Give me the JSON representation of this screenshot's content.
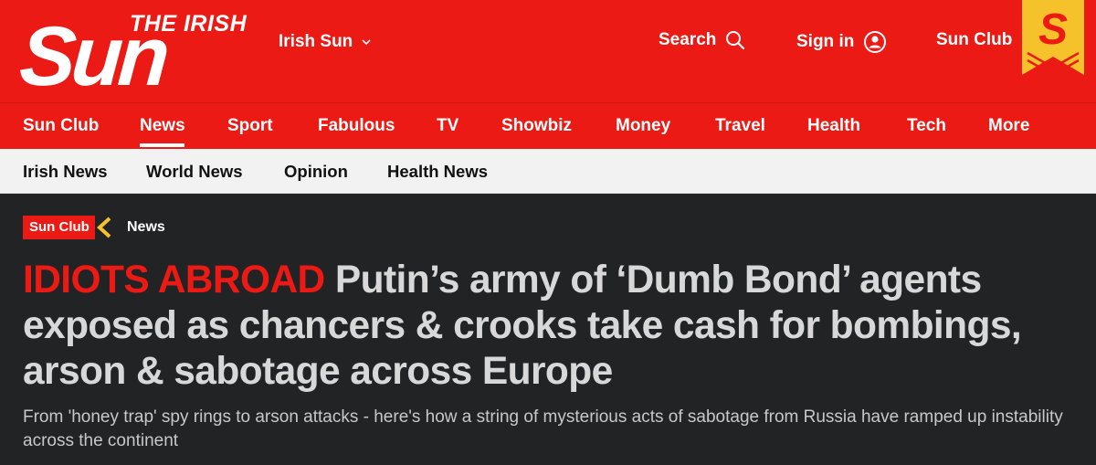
{
  "brand": {
    "logo_small": "THE IRISH",
    "logo_big": "Sun",
    "badge_letter": "S"
  },
  "header": {
    "edition_label": "Irish Sun",
    "search_label": "Search",
    "signin_label": "Sign in",
    "sunclub_label": "Sun Club",
    "colors": {
      "brand_red": "#eb1a14",
      "badge_yellow": "#f6c22b"
    }
  },
  "main_nav": {
    "items": [
      {
        "label": "Sun Club"
      },
      {
        "label": "News"
      },
      {
        "label": "Sport"
      },
      {
        "label": "Fabulous"
      },
      {
        "label": "TV"
      },
      {
        "label": "Showbiz"
      },
      {
        "label": "Money"
      },
      {
        "label": "Travel"
      },
      {
        "label": "Health"
      },
      {
        "label": "Tech"
      },
      {
        "label": "More"
      }
    ],
    "active": "News"
  },
  "sub_nav": {
    "items": [
      {
        "label": "Irish News"
      },
      {
        "label": "World News"
      },
      {
        "label": "Opinion"
      },
      {
        "label": "Health News"
      }
    ]
  },
  "article": {
    "tag_primary": "Sun Club",
    "tag_section": "News",
    "kicker": "IDIOTS ABROAD",
    "headline": "Putin’s army of ‘Dumb Bond’ agents exposed as chancers & crooks take cash for bombings, arson & sabotage across Europe",
    "standfirst": "From 'honey trap' spy rings to arson attacks - here's how a string of mysterious acts of sabotage from Russia have ramped up instability across the continent"
  }
}
